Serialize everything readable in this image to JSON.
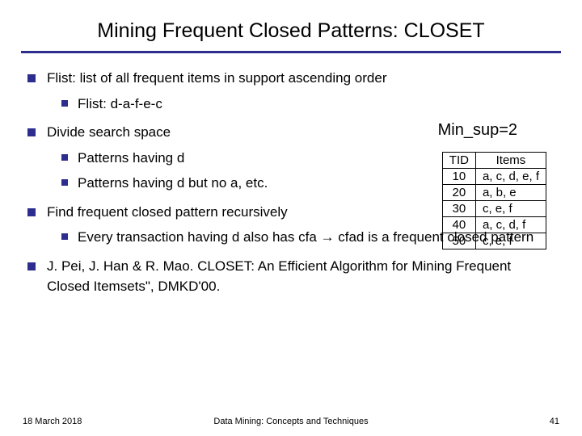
{
  "title": "Mining Frequent Closed Patterns: CLOSET",
  "bullets": {
    "b1": "Flist: list of all frequent items in support ascending order",
    "b1a": "Flist: d-a-f-e-c",
    "b2": "Divide search space",
    "b2a": "Patterns having d",
    "b2b": "Patterns having d but no a, etc.",
    "b3": "Find frequent closed pattern recursively",
    "b3a_pre": "Every transaction having d also has cfa ",
    "b3a_arrow": "→",
    "b3a_post": " cfad is a frequent closed pattern",
    "b4": "J. Pei, J. Han & R. Mao. CLOSET: An Efficient Algorithm for Mining Frequent Closed Itemsets\", DMKD'00."
  },
  "minsup": "Min_sup=2",
  "table": {
    "headers": {
      "tid": "TID",
      "items": "Items"
    },
    "rows": [
      {
        "tid": "10",
        "items": "a, c, d, e, f"
      },
      {
        "tid": "20",
        "items": "a, b, e"
      },
      {
        "tid": "30",
        "items": "c, e, f"
      },
      {
        "tid": "40",
        "items": "a, c, d, f"
      },
      {
        "tid": "50",
        "items": "c, e, f"
      }
    ]
  },
  "footer": {
    "date": "18 March 2018",
    "center": "Data Mining: Concepts and Techniques",
    "page": "41"
  }
}
